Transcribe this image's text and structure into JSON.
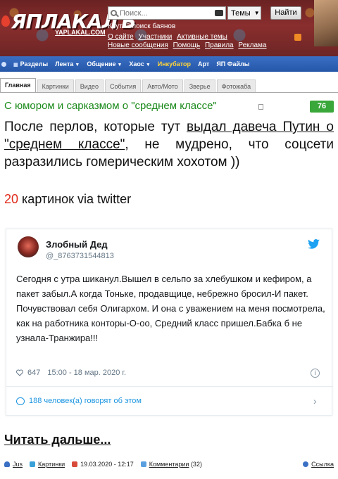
{
  "header": {
    "logo_text": "ЯПЛАКАЛЪ",
    "logo_sub": "YAPLAKAL.COM",
    "search_placeholder": "Поиск...",
    "topics_label": "Темы",
    "find_button": "Найти",
    "tagline": "Крутой поиск баянов",
    "links_row1": [
      "О сайте",
      "Участники",
      "Активные темы"
    ],
    "links_row2": [
      "Новые сообщения",
      "Помощь",
      "Правила",
      "Реклама"
    ]
  },
  "nav": {
    "items": [
      {
        "label": "Разделы",
        "dropdown": false
      },
      {
        "label": "Лента",
        "dropdown": true
      },
      {
        "label": "Общение",
        "dropdown": true
      },
      {
        "label": "Хаос",
        "dropdown": true
      },
      {
        "label": "Инкубатор",
        "dropdown": false
      },
      {
        "label": "Арт",
        "dropdown": false
      },
      {
        "label": "ЯП Файлы",
        "dropdown": false
      }
    ]
  },
  "tabs": [
    "Главная",
    "Картинки",
    "Видео",
    "События",
    "Авто/Мото",
    "Зверье",
    "Фотожаба"
  ],
  "article": {
    "title": "С юмором и сарказмом о \"среднем классе\"",
    "score": "76",
    "body_before": "После перлов, которые тут ",
    "body_link": "выдал давеча Путин о \"среднем классе\"",
    "body_after": ", не мудрено, что соцсети разразились гомерическим хохотом ))",
    "count_num": "20",
    "count_text": " картинок via twitter"
  },
  "tweet": {
    "name": "Злобный Дед",
    "handle": "@_8763731544813",
    "text": "Сегодня с утра шиканул.Вышел в сельпо за хлебушком и кефиром, а пакет забыл.А когда Тоньке, продавщице, небрежно бросил-И пакет. Почувствовал себя Олигархом. И она с уважением на меня посмотрела, как на работника конторы-О-оо, Средний класс пришел.Бабка б не узнала-Транжира!!!",
    "likes": "647",
    "time": "15:00 - 18 мар. 2020 г.",
    "replies": "188 человек(а) говорят об этом"
  },
  "footer": {
    "read_more": "Читать дальше...",
    "author": "Jus",
    "category": "Картинки",
    "date": "19.03.2020 - 12:17",
    "comments_label": "Комментарии",
    "comments_count": "(32)",
    "link_label": "Ссылка"
  },
  "colors": {
    "header_bg": "#7a2828",
    "nav_bg": "#2d62b6",
    "title_green": "#1a8a1a",
    "score_bg": "#3aa73a",
    "accent_red": "#e02a1a",
    "twitter_blue": "#1b95e0"
  }
}
